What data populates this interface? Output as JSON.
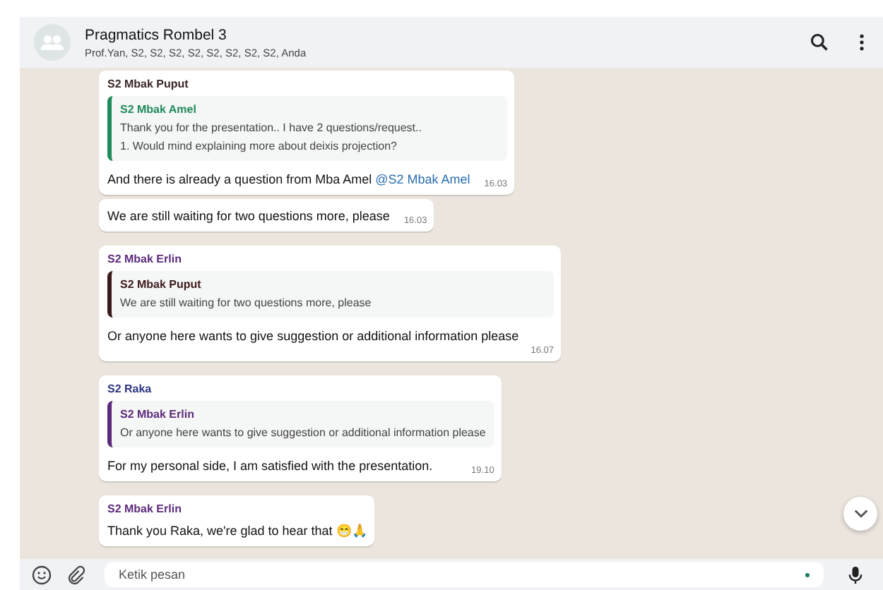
{
  "header": {
    "title": "Pragmatics Rombel 3",
    "members": "Prof.Yan, S2, S2, S2, S2, S2, S2, S2, S2, Anda"
  },
  "messages": [
    {
      "sender": "S2 Mbak Puput",
      "color": "#3b2626",
      "quote": {
        "author": "S2 Mbak Amel",
        "color": "#1f8a5a",
        "lines": [
          "Thank you for the presentation.. I have 2 questions/request..",
          "1. Would mind explaining more about deixis projection?"
        ]
      },
      "text": "And there is already a question from Mba Amel ",
      "mention": "@S2 Mbak Amel",
      "time": "16.03"
    },
    {
      "text": "We are still waiting for two questions more, please",
      "time": "16.03"
    },
    {
      "sender": "S2 Mbak Erlin",
      "color": "#5b2a7a",
      "quote": {
        "author": "S2 Mbak Puput",
        "color": "#3b1a1a",
        "lines": [
          "We are still waiting for two questions more, please"
        ]
      },
      "text": "Or anyone here wants to give suggestion or additional information please",
      "time": "16.07"
    },
    {
      "sender": "S2 Raka",
      "color": "#2c3580",
      "quote": {
        "author": "S2 Mbak Erlin",
        "color": "#5b2a7a",
        "lines": [
          "Or anyone here wants to give suggestion or additional information please"
        ]
      },
      "text": "For my personal side, I am satisfied with the presentation.",
      "time": "19.10"
    },
    {
      "sender": "S2 Mbak Erlin",
      "color": "#5b2a7a",
      "text": "Thank you Raka, we're glad to hear that 😁🙏"
    }
  ],
  "composer": {
    "placeholder": "Ketik pesan"
  }
}
